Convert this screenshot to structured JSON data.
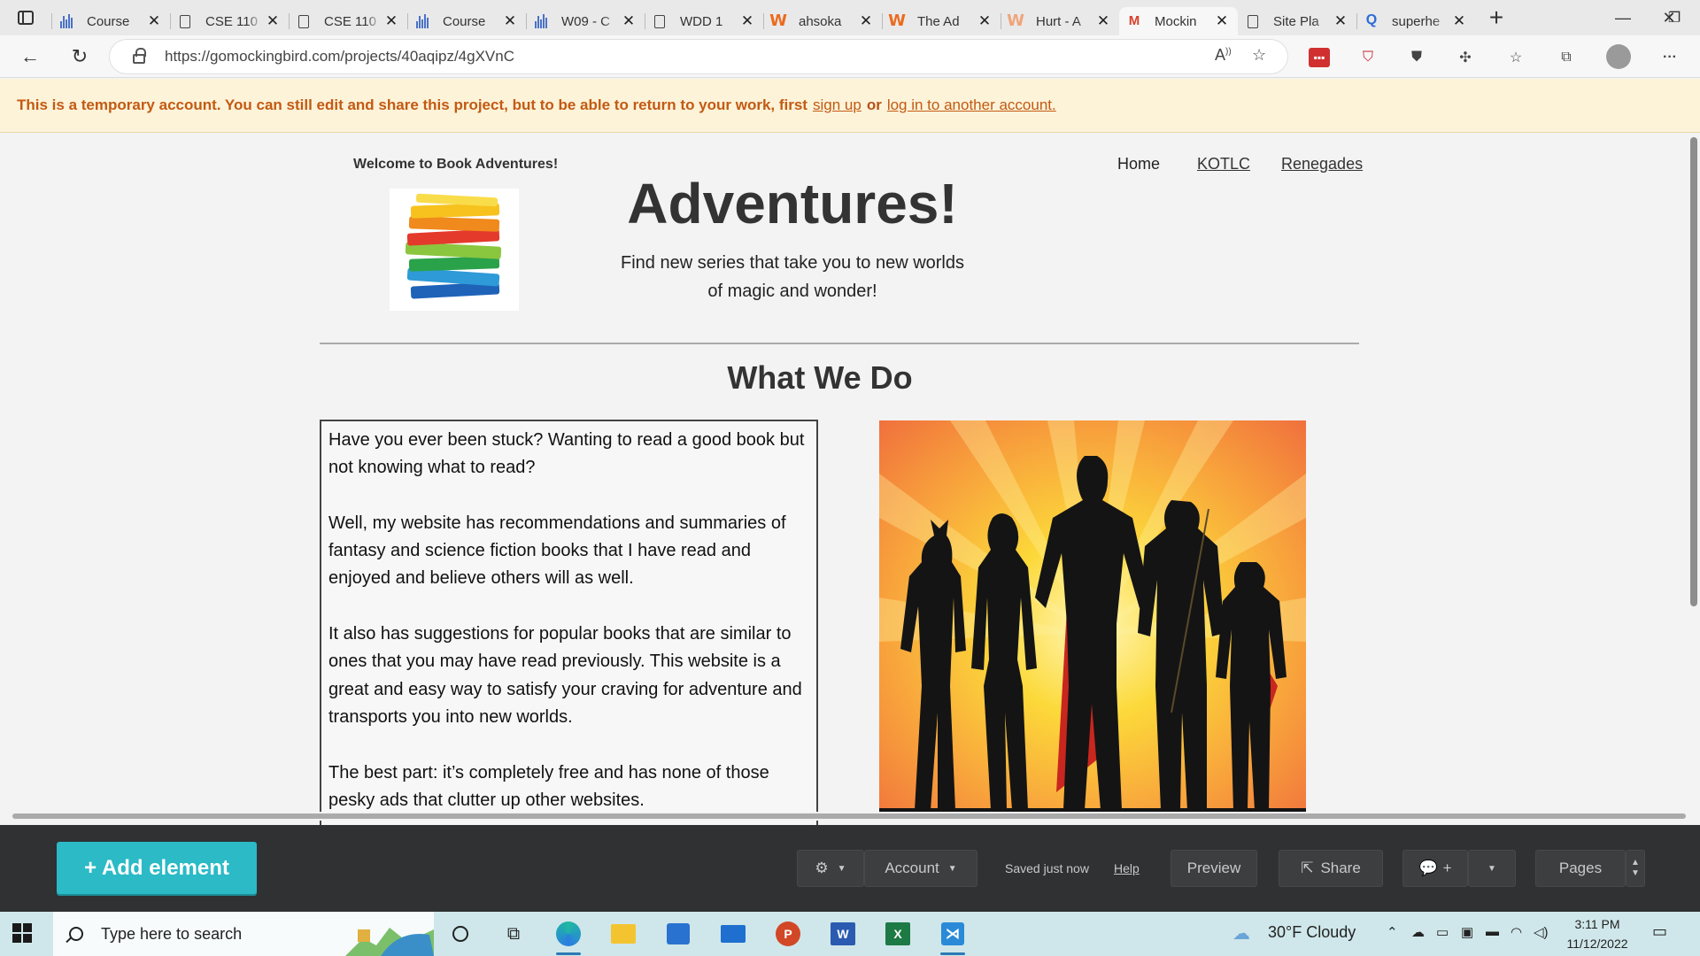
{
  "browser": {
    "tabs": [
      {
        "label": "Course",
        "icon": "bar-chart-icon"
      },
      {
        "label": "CSE 110",
        "icon": "document-icon"
      },
      {
        "label": "CSE 110",
        "icon": "document-icon"
      },
      {
        "label": "Course",
        "icon": "bar-chart-icon"
      },
      {
        "label": "W09 - C",
        "icon": "bar-chart-icon"
      },
      {
        "label": "WDD 1",
        "icon": "document-icon"
      },
      {
        "label": "ahsoka",
        "icon": "wattpad-icon"
      },
      {
        "label": "The Ad",
        "icon": "wattpad-icon"
      },
      {
        "label": "Hurt - A",
        "icon": "wattpad-icon"
      },
      {
        "label": "Mockin",
        "icon": "mockingbird-icon",
        "active": true
      },
      {
        "label": "Site Pla",
        "icon": "document-icon"
      },
      {
        "label": "superhe",
        "icon": "search-icon"
      }
    ],
    "url": "https://gomockingbird.com/projects/40aqipz/4gXVnC"
  },
  "banner": {
    "text": "This is a temporary account. You can still edit and share this project, but to be able to return to your work, first",
    "signup": "sign up",
    "or": "or",
    "login": "log in to another account."
  },
  "site": {
    "welcome": "Welcome to Book Adventures!",
    "nav": [
      "Home",
      "KOTLC",
      "Renegades"
    ],
    "title": "Adventures!",
    "subtitle": "Find new series that take you to new worlds of magic and wonder!",
    "section_title": "What We Do",
    "paragraphs": [
      "Have you ever been stuck? Wanting to read a good book but not knowing what to read?",
      "Well, my website has recommendations and summaries of fantasy and science fiction books that I have read and enjoyed and believe others will as well.",
      "It also has suggestions for popular books that are similar to ones that you may have read previously. This website is a great and easy way to satisfy your craving for adventure and transports you into new worlds.",
      "The best part: it’s completely free and has none of those pesky ads that clutter up other websites."
    ]
  },
  "editor": {
    "add_element": "+ Add element",
    "account": "Account",
    "saved": "Saved just now",
    "help": "Help",
    "preview": "Preview",
    "share": "Share",
    "comment_plus": "+",
    "pages": "Pages"
  },
  "taskbar": {
    "search_placeholder": "Type here to search",
    "weather": "30°F  Cloudy",
    "time": "3:11 PM",
    "date": "11/12/2022"
  },
  "colors": {
    "banner_bg": "#fcf3d9",
    "banner_text": "#c35a12",
    "add_button": "#2bbac6",
    "editor_bar": "#2f3133",
    "taskbar": "#cfe7ea"
  }
}
